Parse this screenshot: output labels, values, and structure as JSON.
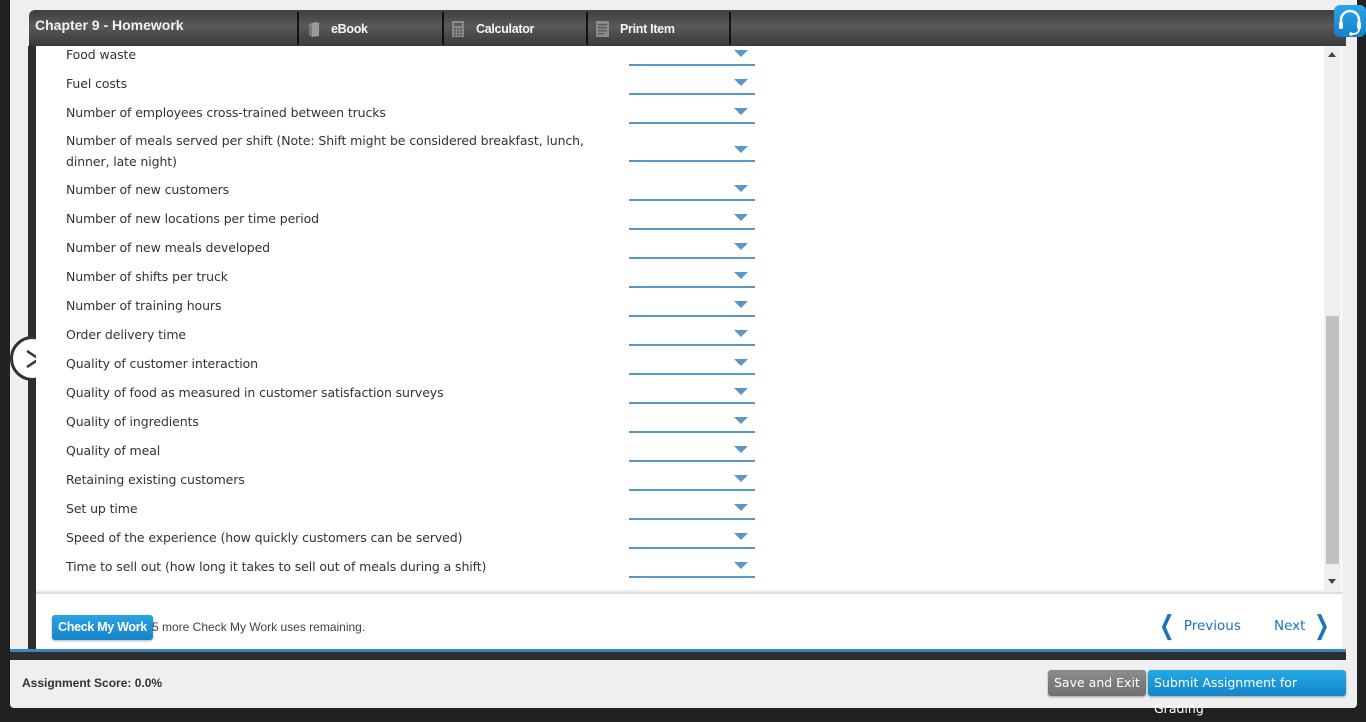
{
  "header": {
    "title": "Chapter 9 - Homework",
    "tools": [
      {
        "label": "eBook",
        "icon": "book-icon"
      },
      {
        "label": "Calculator",
        "icon": "calculator-icon"
      },
      {
        "label": "Print Item",
        "icon": "print-document-icon"
      }
    ],
    "help_icon": "headset-icon"
  },
  "side": {
    "expand_icon": "chevron-right-icon"
  },
  "items": [
    {
      "label": "Food waste",
      "selected": ""
    },
    {
      "label": "Fuel costs",
      "selected": ""
    },
    {
      "label": "Number of employees cross-trained between trucks",
      "selected": ""
    },
    {
      "label": "Number of meals served per shift (Note: Shift might be considered breakfast, lunch, dinner, late night)",
      "selected": ""
    },
    {
      "label": "Number of new customers",
      "selected": ""
    },
    {
      "label": "Number of new locations per time period",
      "selected": ""
    },
    {
      "label": "Number of new meals developed",
      "selected": ""
    },
    {
      "label": "Number of shifts per truck",
      "selected": ""
    },
    {
      "label": "Number of training hours",
      "selected": ""
    },
    {
      "label": "Order delivery time",
      "selected": ""
    },
    {
      "label": "Quality of customer interaction",
      "selected": ""
    },
    {
      "label": "Quality of food as measured in customer satisfaction surveys",
      "selected": ""
    },
    {
      "label": "Quality of ingredients",
      "selected": ""
    },
    {
      "label": "Quality of meal",
      "selected": ""
    },
    {
      "label": "Retaining existing customers",
      "selected": ""
    },
    {
      "label": "Set up time",
      "selected": ""
    },
    {
      "label": "Speed of the experience (how quickly customers can be served)",
      "selected": ""
    },
    {
      "label": "Time to sell out (how long it takes to sell out of meals during a shift)",
      "selected": ""
    }
  ],
  "footer": {
    "check_label": "Check My Work",
    "check_note": "5 more Check My Work uses remaining.",
    "previous_label": "Previous",
    "next_label": "Next"
  },
  "bottom": {
    "score_text": "Assignment Score: 0.0%",
    "save_label": "Save and Exit",
    "submit_label": "Submit Assignment for Grading"
  },
  "colors": {
    "accent": "#1a73bd",
    "button_blue": "#1e96d8",
    "select_line": "#5a97c7"
  }
}
